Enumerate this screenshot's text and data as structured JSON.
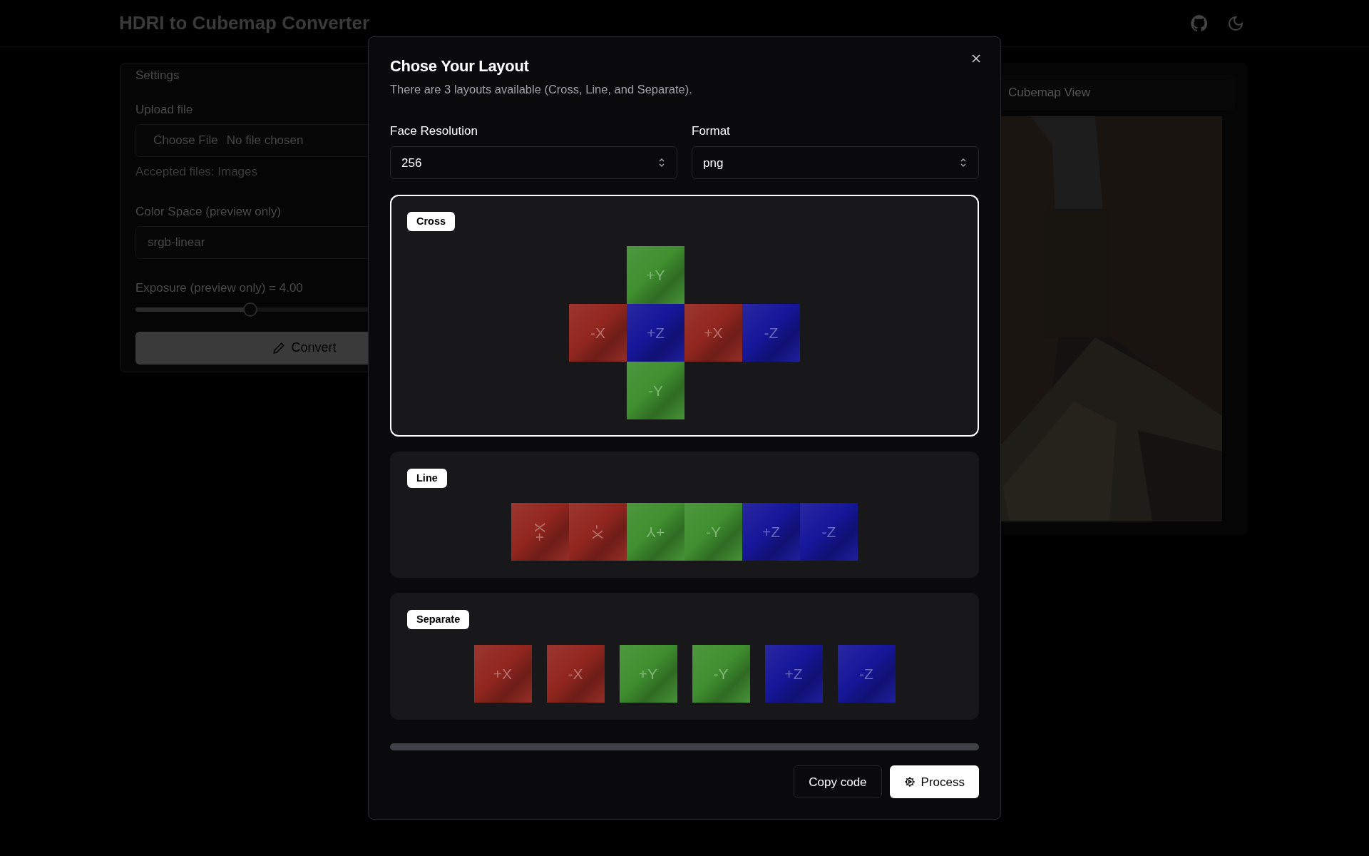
{
  "app": {
    "title": "HDRI to Cubemap Converter"
  },
  "settings": {
    "title": "Settings",
    "upload": {
      "label": "Upload file",
      "button": "Choose File",
      "status": "No file chosen",
      "hint": "Accepted files: Images"
    },
    "color_space": {
      "label": "Color Space (preview only)",
      "value": "srgb-linear"
    },
    "exposure": {
      "label": "Exposure (preview only) = 4.00",
      "level": 0.34
    },
    "convert_button": "Convert"
  },
  "preview": {
    "tab": "Cubemap View",
    "kind": "picture"
  },
  "dialog": {
    "title": "Chose Your Layout",
    "description": "There are 3 layouts available (Cross, Line, and Separate).",
    "fields": [
      {
        "label": "Face Resolution",
        "value": "256"
      },
      {
        "label": "Format",
        "value": "png"
      }
    ],
    "layouts": [
      {
        "name": "Cross",
        "selected": true,
        "kind": "cross",
        "faces": [
          {
            "label": "+Y",
            "color": "#3f8f2f",
            "kind": "upright"
          },
          {
            "label": "-X",
            "color": "#92261f",
            "kind": "upright"
          },
          {
            "label": "+Z",
            "color": "#16169a",
            "kind": "upright"
          },
          {
            "label": "+X",
            "color": "#92261f",
            "kind": "upright"
          },
          {
            "label": "-Z",
            "color": "#16169a",
            "kind": "upright"
          },
          {
            "label": "-Y",
            "color": "#3f8f2f",
            "kind": "upright"
          }
        ]
      },
      {
        "name": "Line",
        "selected": false,
        "kind": "line",
        "faces": [
          {
            "label": "+X",
            "color": "#92261f",
            "kind": "ccw"
          },
          {
            "label": "-X",
            "color": "#92261f",
            "kind": "cw"
          },
          {
            "label": "+Y",
            "color": "#3f8f2f",
            "kind": "flipped"
          },
          {
            "label": "-Y",
            "color": "#3f8f2f",
            "kind": "upright"
          },
          {
            "label": "+Z",
            "color": "#16169a",
            "kind": "upright"
          },
          {
            "label": "-Z",
            "color": "#16169a",
            "kind": "upright"
          }
        ]
      },
      {
        "name": "Separate",
        "selected": false,
        "kind": "separate",
        "faces": [
          {
            "label": "+X",
            "color": "#92261f",
            "kind": "upright"
          },
          {
            "label": "-X",
            "color": "#92261f",
            "kind": "upright"
          },
          {
            "label": "+Y",
            "color": "#3f8f2f",
            "kind": "upright"
          },
          {
            "label": "-Y",
            "color": "#3f8f2f",
            "kind": "upright"
          },
          {
            "label": "+Z",
            "color": "#16169a",
            "kind": "upright"
          },
          {
            "label": "-Z",
            "color": "#16169a",
            "kind": "upright"
          }
        ]
      }
    ],
    "progress": {
      "level": 0
    },
    "buttons": [
      {
        "label": "Copy code",
        "kind": "outline"
      },
      {
        "label": "Process",
        "kind": "primary"
      }
    ]
  }
}
